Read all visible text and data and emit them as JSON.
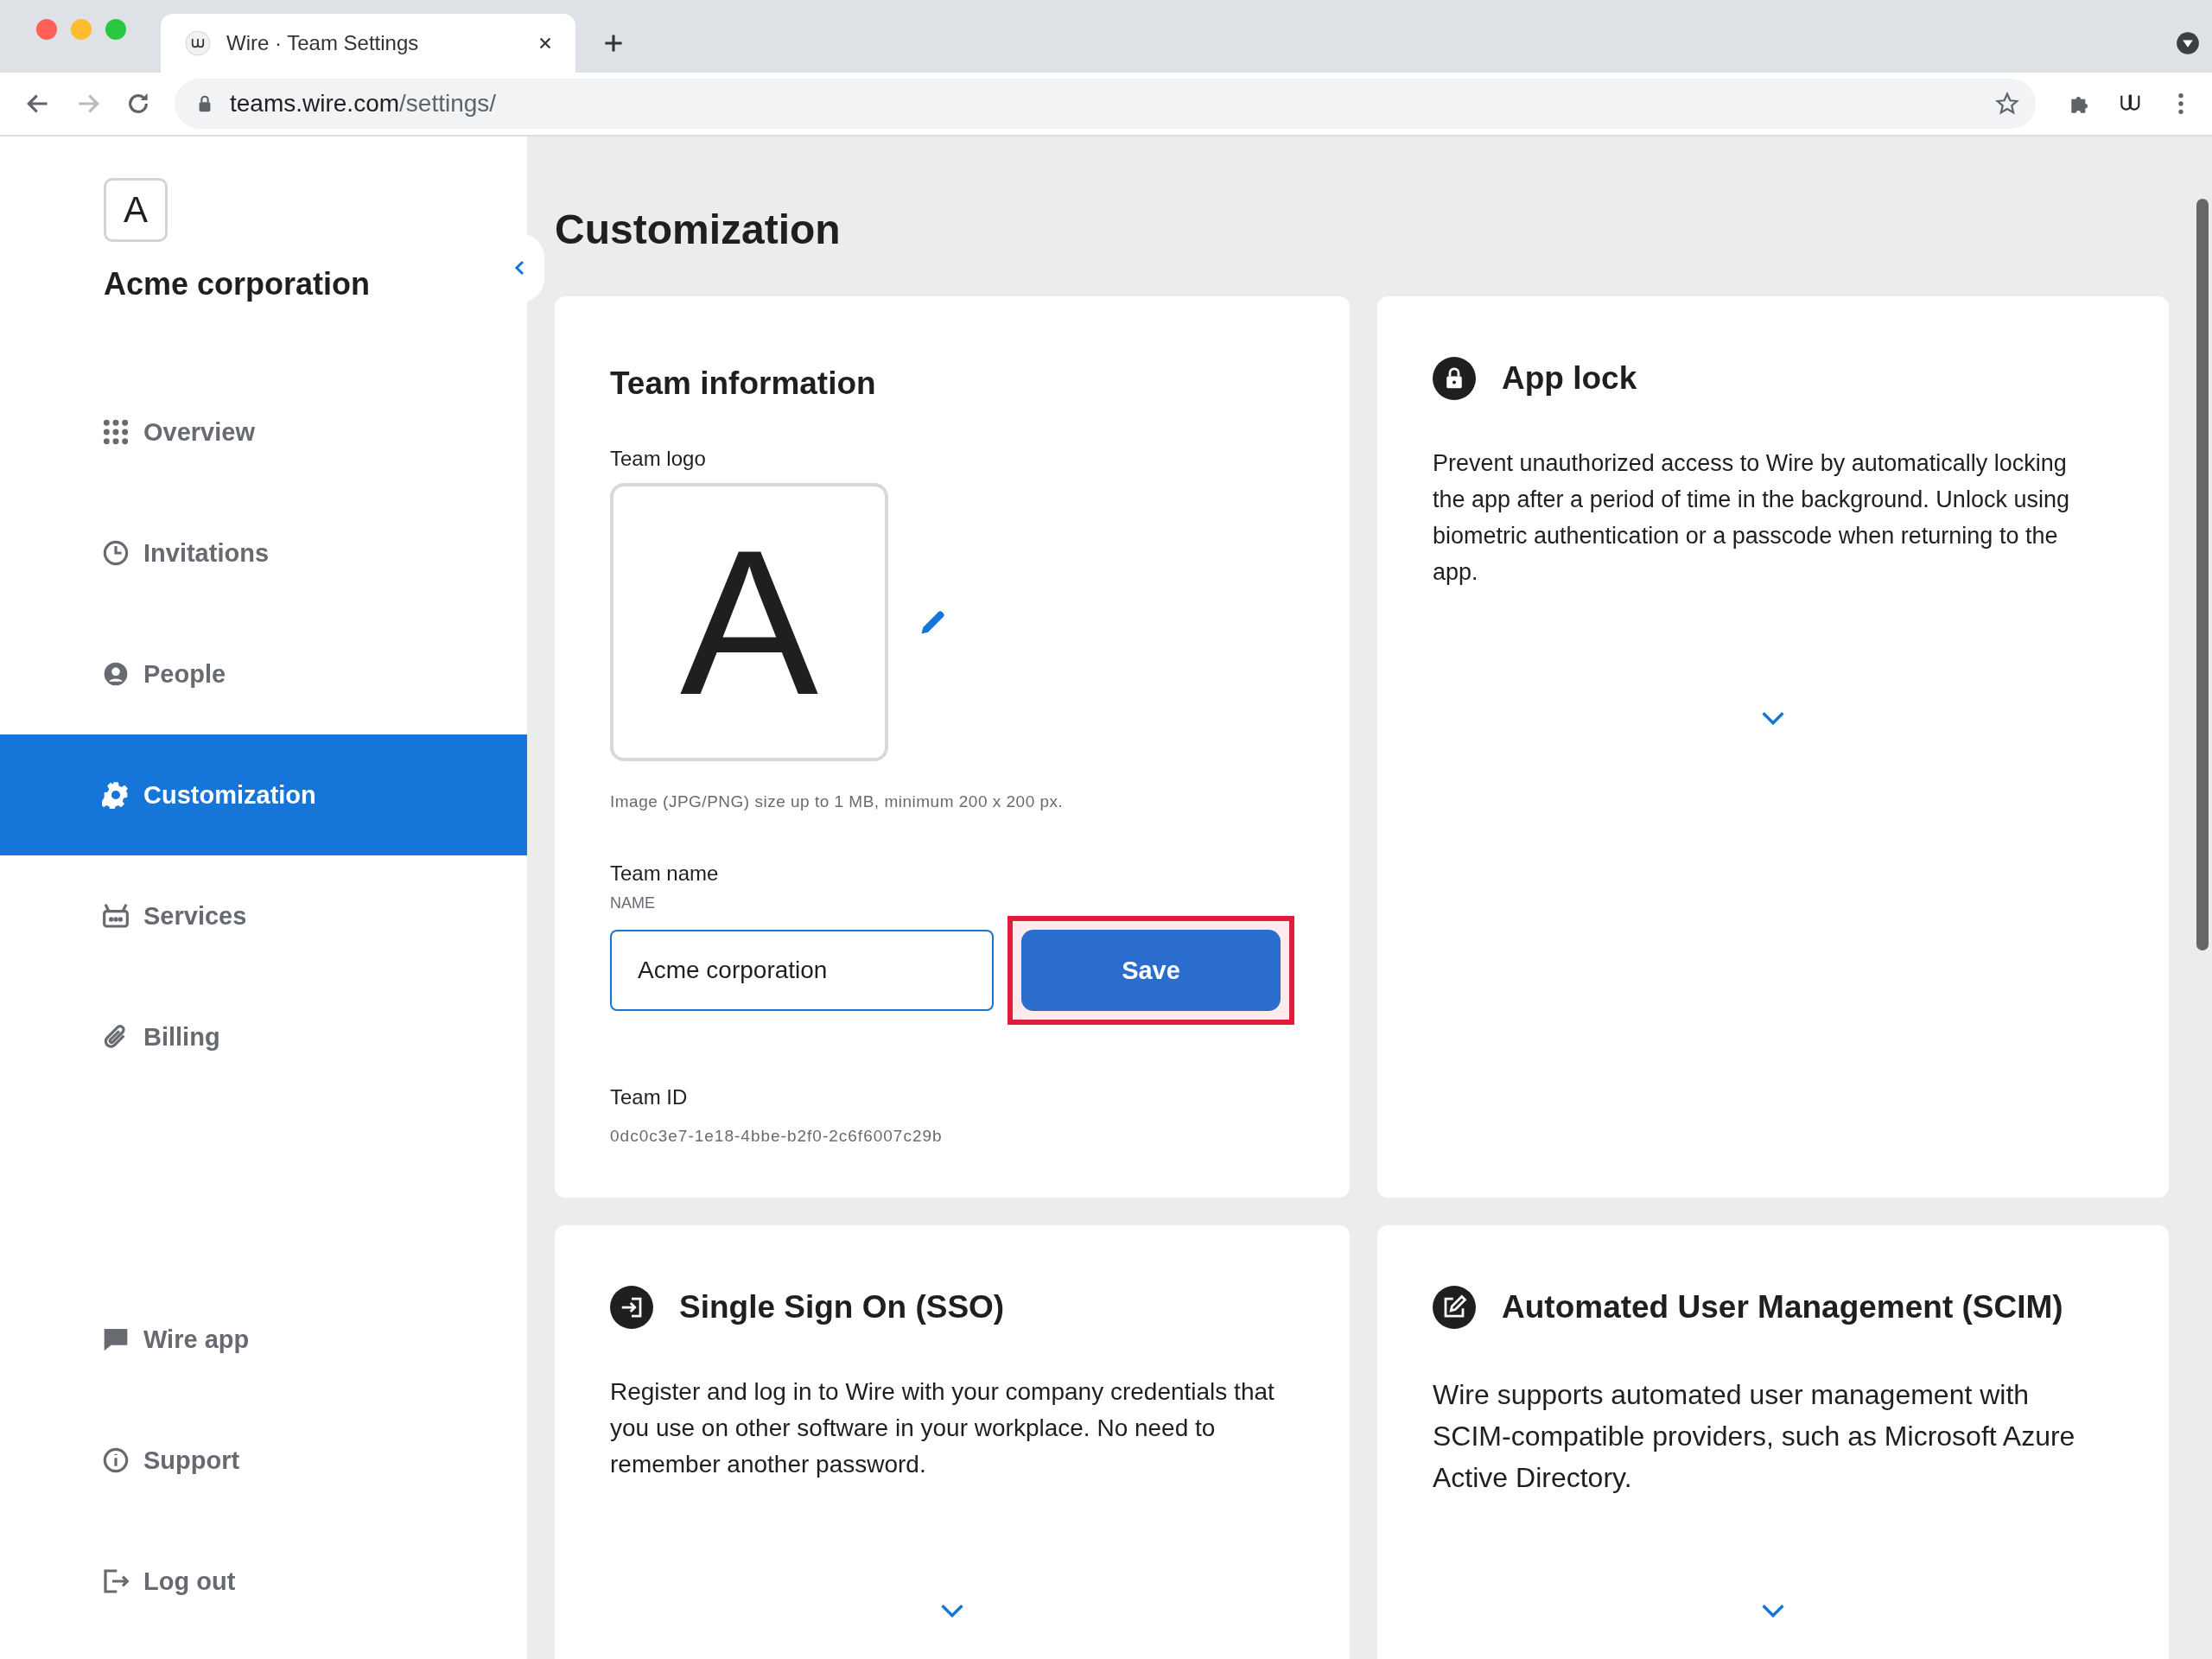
{
  "browser": {
    "tab_title": "Wire · Team Settings",
    "url_host": "teams.wire.com",
    "url_path": "/settings/"
  },
  "sidebar": {
    "team_initial": "A",
    "team_name": "Acme corporation",
    "items": [
      {
        "label": "Overview",
        "kind": "grid",
        "selected": false
      },
      {
        "label": "Invitations",
        "kind": "clock",
        "selected": false
      },
      {
        "label": "People",
        "kind": "person",
        "selected": false
      },
      {
        "label": "Customization",
        "kind": "gear",
        "selected": true
      },
      {
        "label": "Services",
        "kind": "bot",
        "selected": false
      },
      {
        "label": "Billing",
        "kind": "clip",
        "selected": false
      }
    ],
    "footer_items": [
      {
        "label": "Wire app",
        "kind": "chat",
        "selected": false
      },
      {
        "label": "Support",
        "kind": "info",
        "selected": false
      },
      {
        "label": "Log out",
        "kind": "logout",
        "selected": false
      }
    ]
  },
  "page_title": "Customization",
  "team_info": {
    "title": "Team information",
    "logo_label": "Team logo",
    "logo_initial": "A",
    "logo_hint": "Image (JPG/PNG) size up to 1 MB, minimum 200 x 200 px.",
    "name_label": "Team name",
    "field_label": "NAME",
    "name_value": "Acme corporation",
    "save_button": {
      "label": "Save",
      "highlighted": true
    },
    "id_label": "Team ID",
    "id_value": "0dc0c3e7-1e18-4bbe-b2f0-2c6f6007c29b"
  },
  "feature_cards": [
    {
      "kind": "lock",
      "title": "App lock",
      "description": "Prevent unauthorized access to Wire by automatically locking the app after a period of time in the background. Unlock using biometric authentication or a passcode when returning to the app.",
      "expanded": false
    },
    {
      "kind": "signin",
      "title": "Single Sign On (SSO)",
      "description": "Register and log in to Wire with your company credentials that you use on other software in your workplace. No need to remember another password.",
      "expanded": false
    },
    {
      "kind": "edit",
      "title": "Automated User Management (SCIM)",
      "description": "Wire supports automated user management with SCIM-compatible providers, such as Microsoft Azure Active Directory.",
      "expanded": false
    }
  ]
}
